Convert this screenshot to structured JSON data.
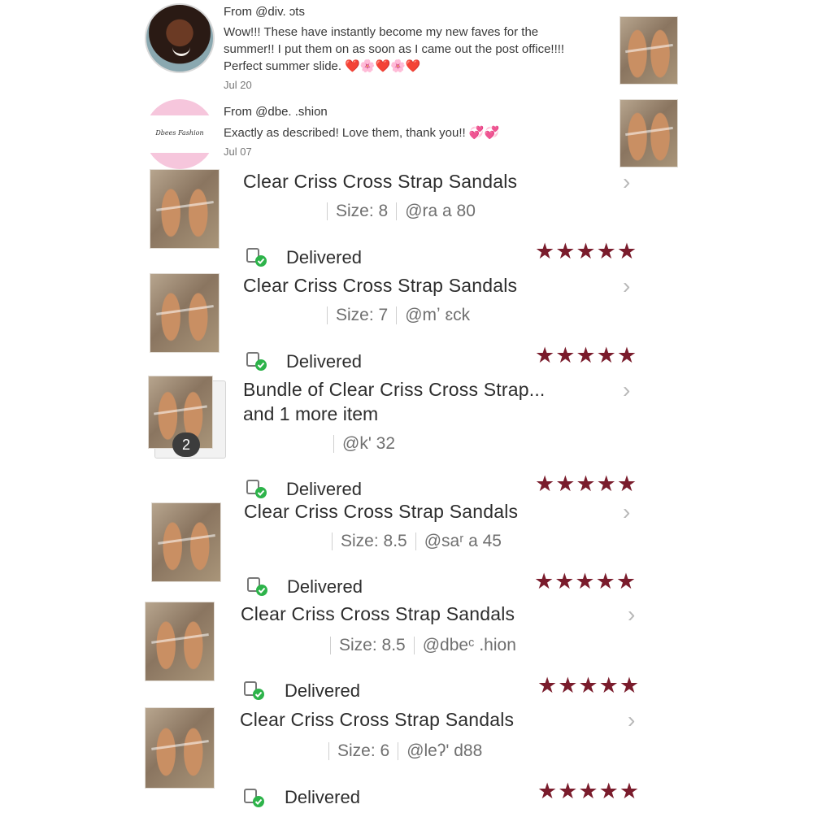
{
  "colors": {
    "star": "#7a1c2c",
    "heart": "#d81f2a",
    "delivered_check": "#2db34a"
  },
  "reviews": [
    {
      "from": "From @div.  ɔts",
      "text": "Wow!!! These have instantly become my new faves for the summer!! I put them on as soon as I came out the post office!!!! Perfect summer slide.",
      "emoji": "❤️🌸❤️🌸❤️",
      "date": "Jul 20",
      "avatar_icon": "avatar-photo-icon"
    },
    {
      "from": "From @dbe.   .shion",
      "text": "Exactly as described! Love them, thank you!!",
      "emoji": "💞💞",
      "date": "Jul 07",
      "avatar_logo_text": "Dbees Fashion"
    }
  ],
  "orders": [
    {
      "title": "Clear Criss Cross Strap Sandals",
      "size": "Size: 8",
      "user": "@ra     а 80",
      "status": "Delivered",
      "stars": "★★★★★"
    },
    {
      "title": "Clear Criss Cross Strap Sandals",
      "size": "Size: 7",
      "user": "@mʼ   ɛck",
      "status": "Delivered",
      "stars": "★★★★★"
    },
    {
      "title": "Bundle of Clear Criss Cross Strap...",
      "title_line2": "and 1 more item",
      "user": "@k'      32",
      "badge": "2",
      "status": "Delivered",
      "stars": "★★★★★"
    },
    {
      "title": "Clear Criss Cross Strap Sandals",
      "size": "Size: 8.5",
      "user": "@saʳ     а 45",
      "status": "Delivered",
      "stars": "★★★★★"
    },
    {
      "title": "Clear Criss Cross Strap Sandals",
      "size": "Size: 8.5",
      "user": "@dbeᶜ      .hion",
      "status": "Delivered",
      "stars": "★★★★★"
    },
    {
      "title": "Clear Criss Cross Strap Sandals",
      "size": "Size: 6",
      "user": "@leʔ'    d88",
      "status": "Delivered",
      "stars": "★★★★★"
    }
  ],
  "icons": {
    "chevron": "chevron-right-icon",
    "delivered": "delivered-truck-icon"
  }
}
